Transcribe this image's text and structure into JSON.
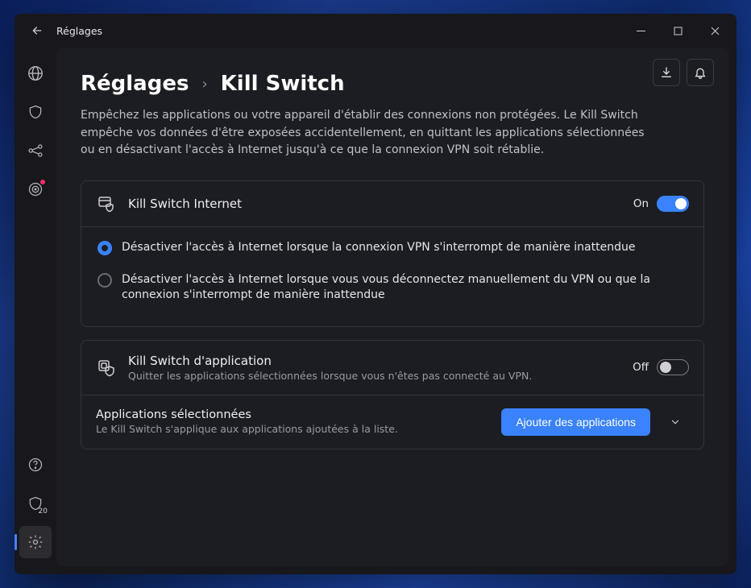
{
  "titlebar": {
    "title": "Réglages"
  },
  "sidebar": {
    "downloads_badge": "20"
  },
  "top_actions": {
    "download_icon": "download",
    "bell_icon": "bell"
  },
  "breadcrumb": {
    "parent": "Réglages",
    "separator": "›",
    "current": "Kill Switch"
  },
  "description": "Empêchez les applications ou votre appareil d'établir des connexions non protégées. Le Kill Switch empêche vos données d'être exposées accidentellement, en quittant les applications sélectionnées ou en désactivant l'accès à Internet jusqu'à ce que la connexion VPN soit rétablie.",
  "internet_ks": {
    "title": "Kill Switch Internet",
    "state_label": "On",
    "state": true,
    "options": [
      {
        "label": "Désactiver l'accès à Internet lorsque la connexion VPN s'interrompt de manière inattendue",
        "selected": true
      },
      {
        "label": "Désactiver l'accès à Internet lorsque vous vous déconnectez manuellement du VPN ou que la connexion s'interrompt de manière inattendue",
        "selected": false
      }
    ]
  },
  "app_ks": {
    "title": "Kill Switch d'application",
    "sub": "Quitter les applications sélectionnées lorsque vous n'êtes pas connecté au VPN.",
    "state_label": "Off",
    "state": false
  },
  "selected_apps": {
    "title": "Applications sélectionnées",
    "sub": "Le Kill Switch s'applique aux applications ajoutées à la liste.",
    "add_button": "Ajouter des applications"
  }
}
